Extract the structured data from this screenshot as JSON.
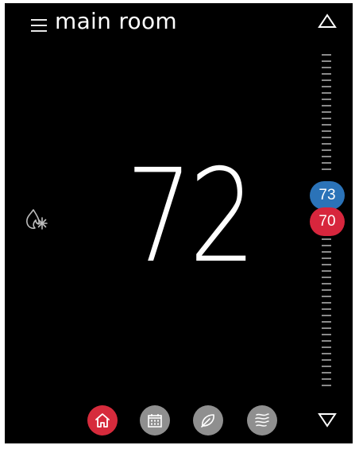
{
  "header": {
    "room_name": "main room"
  },
  "main": {
    "current_temperature": "72"
  },
  "setpoints": {
    "cool": "73",
    "heat": "70"
  },
  "icons": {
    "menu": "hamburger-menu-icon",
    "mode": "heat-cool-mode-icon",
    "up": "up-arrow-icon",
    "down": "down-arrow-icon",
    "home": "home-icon",
    "schedule": "calendar-icon",
    "eco": "leaf-icon",
    "fan": "fan-airflow-icon"
  },
  "colors": {
    "background": "#000000",
    "cool_setpoint": "#2b73b8",
    "heat_setpoint": "#d7263d",
    "active_button": "#d62b3c",
    "inactive_button": "#8f8f8f"
  }
}
